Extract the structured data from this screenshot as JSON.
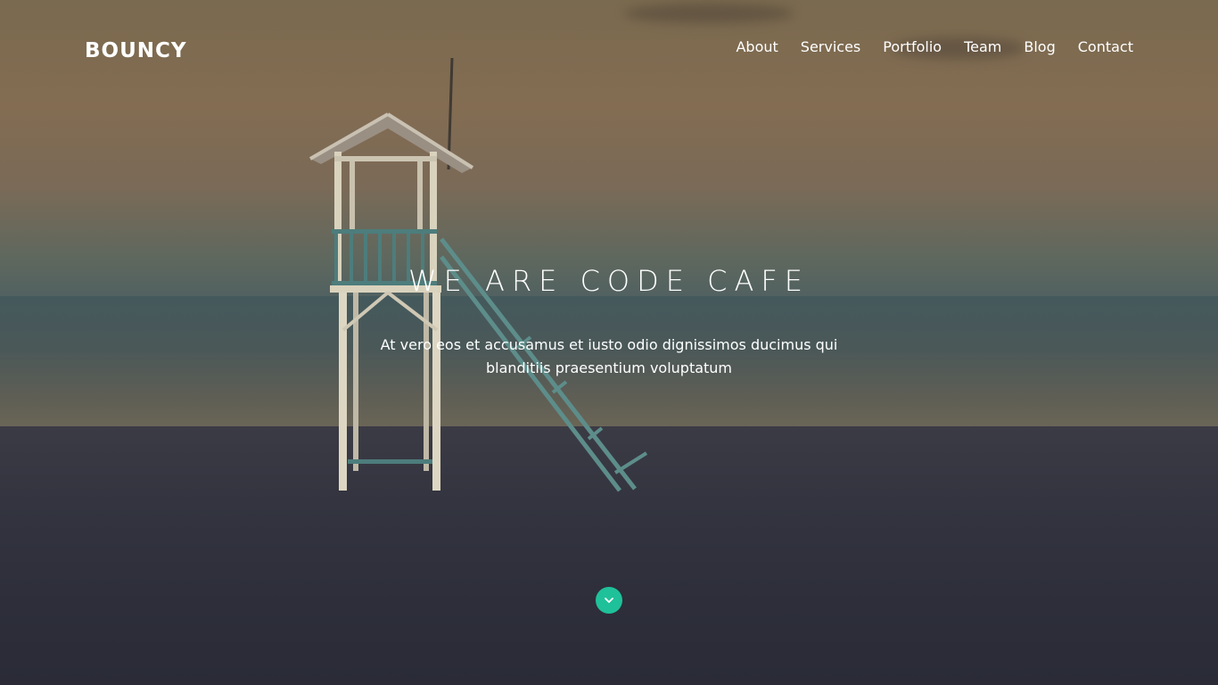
{
  "brand": {
    "logo_text": "BOUNCY"
  },
  "nav": {
    "items": [
      {
        "label": "About"
      },
      {
        "label": "Services"
      },
      {
        "label": "Portfolio"
      },
      {
        "label": "Team"
      },
      {
        "label": "Blog"
      },
      {
        "label": "Contact"
      }
    ]
  },
  "hero": {
    "title": "WE ARE CODE CAFE",
    "subtitle": "At vero eos et accusamus et iusto odio dignissimos ducimus qui blanditiis praesentium voluptatum",
    "scroll_icon": "chevron-down-icon",
    "background_image": "beach-lifeguard-tower"
  },
  "colors": {
    "accent": "#1fc19a",
    "text": "#ffffff"
  }
}
